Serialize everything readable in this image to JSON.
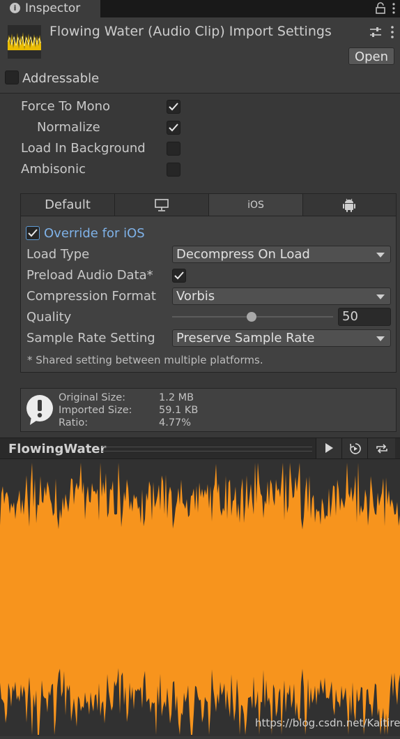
{
  "tab": {
    "title": "Inspector",
    "info_icon": "info-icon"
  },
  "header": {
    "title": "Flowing Water (Audio Clip) Import Settings",
    "open_label": "Open",
    "addressable_label": "Addressable",
    "addressable_checked": false
  },
  "settings": {
    "force_to_mono": {
      "label": "Force To Mono",
      "checked": true
    },
    "normalize": {
      "label": "Normalize",
      "checked": true
    },
    "load_in_background": {
      "label": "Load In Background",
      "checked": false
    },
    "ambisonic": {
      "label": "Ambisonic",
      "checked": false
    }
  },
  "platform_tabs": [
    {
      "label": "Default",
      "icon": null
    },
    {
      "label": "",
      "icon": "monitor-icon"
    },
    {
      "label": "iOS",
      "icon": null,
      "active": true
    },
    {
      "label": "",
      "icon": "android-icon"
    }
  ],
  "platform": {
    "override_label": "Override for iOS",
    "override_checked": true,
    "load_type_label": "Load Type",
    "load_type_value": "Decompress On Load",
    "preload_label": "Preload Audio Data*",
    "preload_checked": true,
    "compression_label": "Compression Format",
    "compression_value": "Vorbis",
    "quality_label": "Quality",
    "quality_value": "50",
    "quality_fraction": 0.5,
    "sample_rate_label": "Sample Rate Setting",
    "sample_rate_value": "Preserve Sample Rate",
    "note": "* Shared setting between multiple platforms."
  },
  "info": {
    "original_label": "Original Size:",
    "original_value": "1.2 MB",
    "imported_label": "Imported Size:",
    "imported_value": "59.1 KB",
    "ratio_label": "Ratio:",
    "ratio_value": "4.77%"
  },
  "preview": {
    "title": "FlowingWater"
  },
  "watermark": "https://blog.csdn.net/Kaitiren",
  "colors": {
    "accent": "#7fb2e8",
    "waveform": "#f7941d",
    "background": "#383838"
  }
}
